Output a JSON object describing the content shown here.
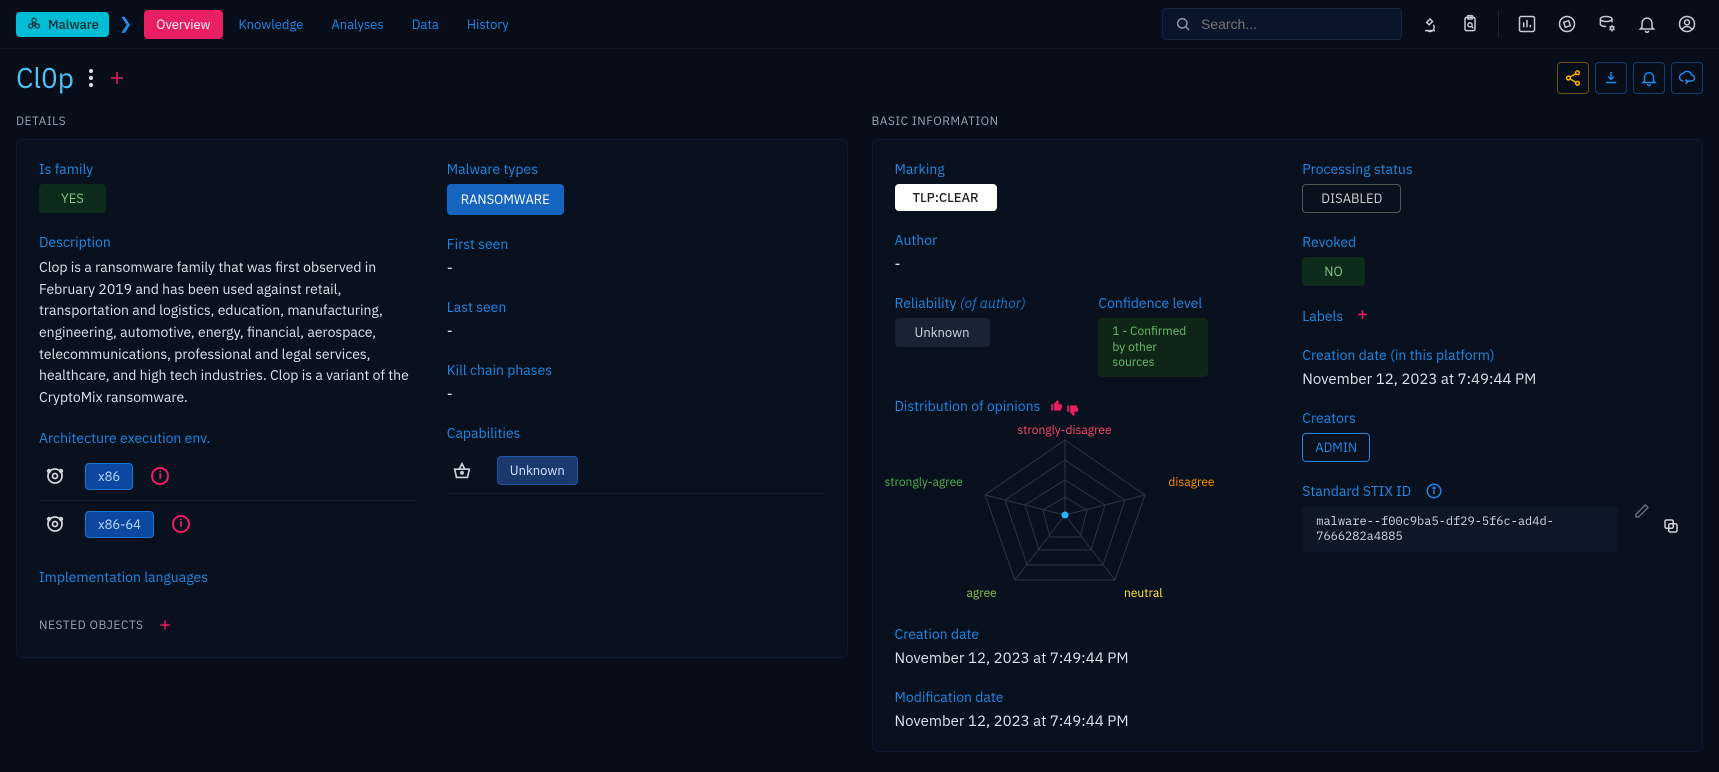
{
  "breadcrumb": {
    "root": "Malware"
  },
  "tabs": [
    "Overview",
    "Knowledge",
    "Analyses",
    "Data",
    "History"
  ],
  "search": {
    "placeholder": "Search..."
  },
  "title": "Cl0p",
  "details": {
    "heading": "DETAILS",
    "is_family_label": "Is family",
    "is_family_value": "YES",
    "description_label": "Description",
    "description": "Clop is a ransomware family that was first observed in February 2019 and has been used against retail, transportation and logistics, education, manufacturing, engineering, automotive, energy, financial, aerospace, telecommunications, professional and legal services, healthcare, and high tech industries. Clop is a variant of the CryptoMix ransomware.",
    "arch_label": "Architecture execution env.",
    "arch": [
      "x86",
      "x86-64"
    ],
    "impl_lang_label": "Implementation languages",
    "malware_types_label": "Malware types",
    "malware_types": [
      "RANSOMWARE"
    ],
    "first_seen_label": "First seen",
    "first_seen": "-",
    "last_seen_label": "Last seen",
    "last_seen": "-",
    "kill_chain_label": "Kill chain phases",
    "kill_chain": "-",
    "capabilities_label": "Capabilities",
    "capabilities": [
      "Unknown"
    ],
    "nested": "NESTED OBJECTS"
  },
  "basic": {
    "heading": "BASIC INFORMATION",
    "marking_label": "Marking",
    "marking": "TLP:CLEAR",
    "author_label": "Author",
    "author": "-",
    "reliability_label": "Reliability",
    "reliability_suffix": "(of author)",
    "reliability": "Unknown",
    "confidence_label": "Confidence level",
    "confidence": "1 - Confirmed by other sources",
    "opinions_label": "Distribution of opinions",
    "opinion_labels": {
      "strongly_disagree": "strongly-disagree",
      "disagree": "disagree",
      "neutral": "neutral",
      "agree": "agree",
      "strongly_agree": "strongly-agree"
    },
    "creation_label": "Creation date",
    "creation": "November 12, 2023 at 7:49:44 PM",
    "modification_label": "Modification date",
    "modification": "November 12, 2023 at 7:49:44 PM",
    "processing_label": "Processing status",
    "processing": "DISABLED",
    "revoked_label": "Revoked",
    "revoked": "NO",
    "labels_label": "Labels",
    "platform_creation_label": "Creation date (in this platform)",
    "platform_creation": "November 12, 2023 at 7:49:44 PM",
    "creators_label": "Creators",
    "creators": [
      "ADMIN"
    ],
    "stix_label": "Standard STIX ID",
    "stix_id": "malware--f00c9ba5-df29-5f6c-ad4d-7666282a4885"
  }
}
